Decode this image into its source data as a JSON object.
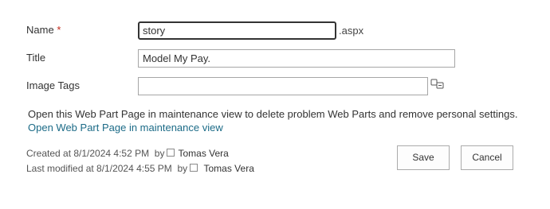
{
  "fields": {
    "name": {
      "label": "Name",
      "required_mark": "*",
      "value": "story",
      "suffix": ".aspx"
    },
    "title": {
      "label": "Title",
      "value": "Model My Pay."
    },
    "image_tags": {
      "label": "Image Tags",
      "value": ""
    }
  },
  "maintenance": {
    "text": "Open this Web Part Page in maintenance view to delete problem Web Parts and remove personal settings.",
    "link": "Open Web Part Page in maintenance view"
  },
  "metadata": {
    "created_prefix": "Created at 8/1/2024 4:52 PM",
    "created_by_word": "by",
    "created_user": "Tomas Vera",
    "modified_prefix": "Last modified at 8/1/2024 4:55 PM",
    "modified_by_word": "by",
    "modified_user": "Tomas Vera"
  },
  "buttons": {
    "save": "Save",
    "cancel": "Cancel"
  },
  "icons": {
    "image_tags": "tag-picker-icon"
  }
}
